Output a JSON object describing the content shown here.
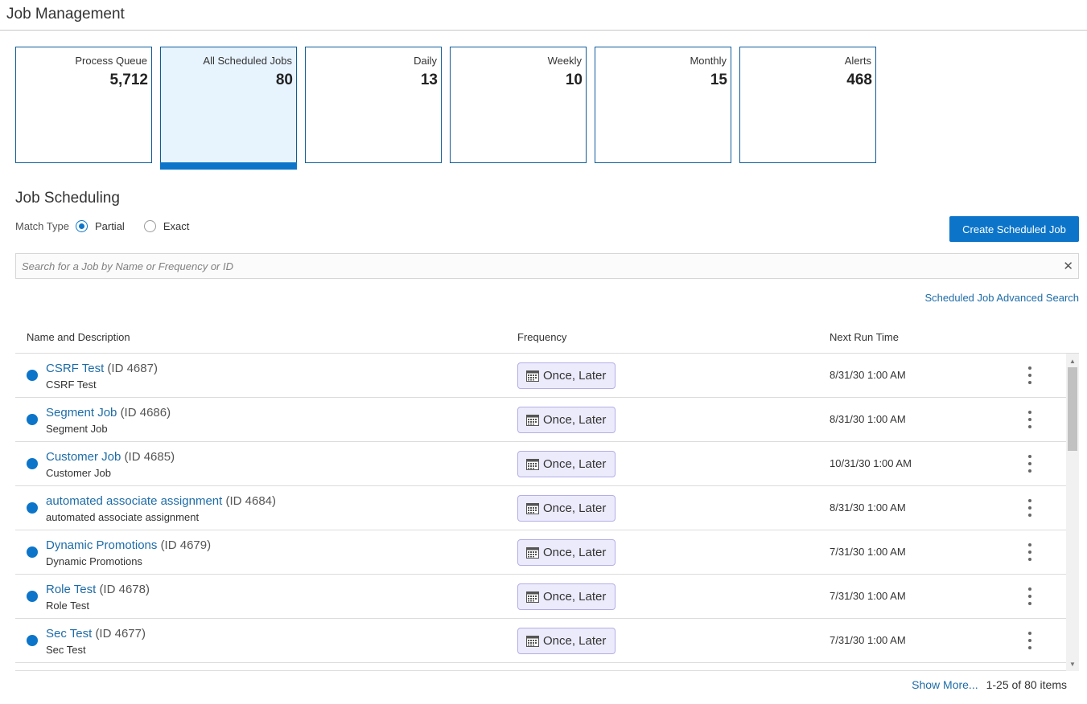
{
  "header": {
    "title": "Job Management"
  },
  "tiles": [
    {
      "label": "Process Queue",
      "count": "5,712",
      "selected": false
    },
    {
      "label": "All Scheduled Jobs",
      "count": "80",
      "selected": true
    },
    {
      "label": "Daily",
      "count": "13",
      "selected": false
    },
    {
      "label": "Weekly",
      "count": "10",
      "selected": false
    },
    {
      "label": "Monthly",
      "count": "15",
      "selected": false
    },
    {
      "label": "Alerts",
      "count": "468",
      "selected": false
    }
  ],
  "section": {
    "title": "Job Scheduling"
  },
  "match_type": {
    "label": "Match Type",
    "options": [
      "Partial",
      "Exact"
    ],
    "selected": "Partial"
  },
  "create_button": {
    "label": "Create Scheduled Job"
  },
  "search": {
    "placeholder": "Search for a Job by Name or Frequency or ID",
    "value": "",
    "clear_icon": "close-icon"
  },
  "advanced_search_link": "Scheduled Job Advanced Search",
  "table": {
    "columns": [
      "Name and Description",
      "Frequency",
      "Next Run Time"
    ],
    "rows": [
      {
        "name": "CSRF Test",
        "id": "(ID 4687)",
        "description": "CSRF Test",
        "frequency": "Once, Later",
        "next_run": "8/31/30 1:00 AM"
      },
      {
        "name": "Segment Job",
        "id": "(ID 4686)",
        "description": "Segment Job",
        "frequency": "Once, Later",
        "next_run": "8/31/30 1:00 AM"
      },
      {
        "name": "Customer Job",
        "id": "(ID 4685)",
        "description": "Customer Job",
        "frequency": "Once, Later",
        "next_run": "10/31/30 1:00 AM"
      },
      {
        "name": "automated associate assignment",
        "id": "(ID 4684)",
        "description": "automated associate assignment",
        "frequency": "Once, Later",
        "next_run": "8/31/30 1:00 AM"
      },
      {
        "name": "Dynamic Promotions",
        "id": "(ID 4679)",
        "description": "Dynamic Promotions",
        "frequency": "Once, Later",
        "next_run": "7/31/30 1:00 AM"
      },
      {
        "name": "Role Test",
        "id": "(ID 4678)",
        "description": "Role Test",
        "frequency": "Once, Later",
        "next_run": "7/31/30 1:00 AM"
      },
      {
        "name": "Sec Test",
        "id": "(ID 4677)",
        "description": "Sec Test",
        "frequency": "Once, Later",
        "next_run": "7/31/30 1:00 AM"
      }
    ]
  },
  "footer": {
    "show_more": "Show More...",
    "range": "1-25 of 80 items"
  },
  "colors": {
    "accent": "#0c75c9",
    "link": "#1d6ca8",
    "tile_border": "#0f5c99",
    "tile_selected_bg": "#e7f3fd",
    "freq_badge_bg": "#ecebfb",
    "freq_badge_border": "#b3aee6"
  },
  "icons": {
    "status": "status-dot-icon",
    "frequency": "calendar-icon",
    "row_menu": "more-vertical-icon"
  }
}
